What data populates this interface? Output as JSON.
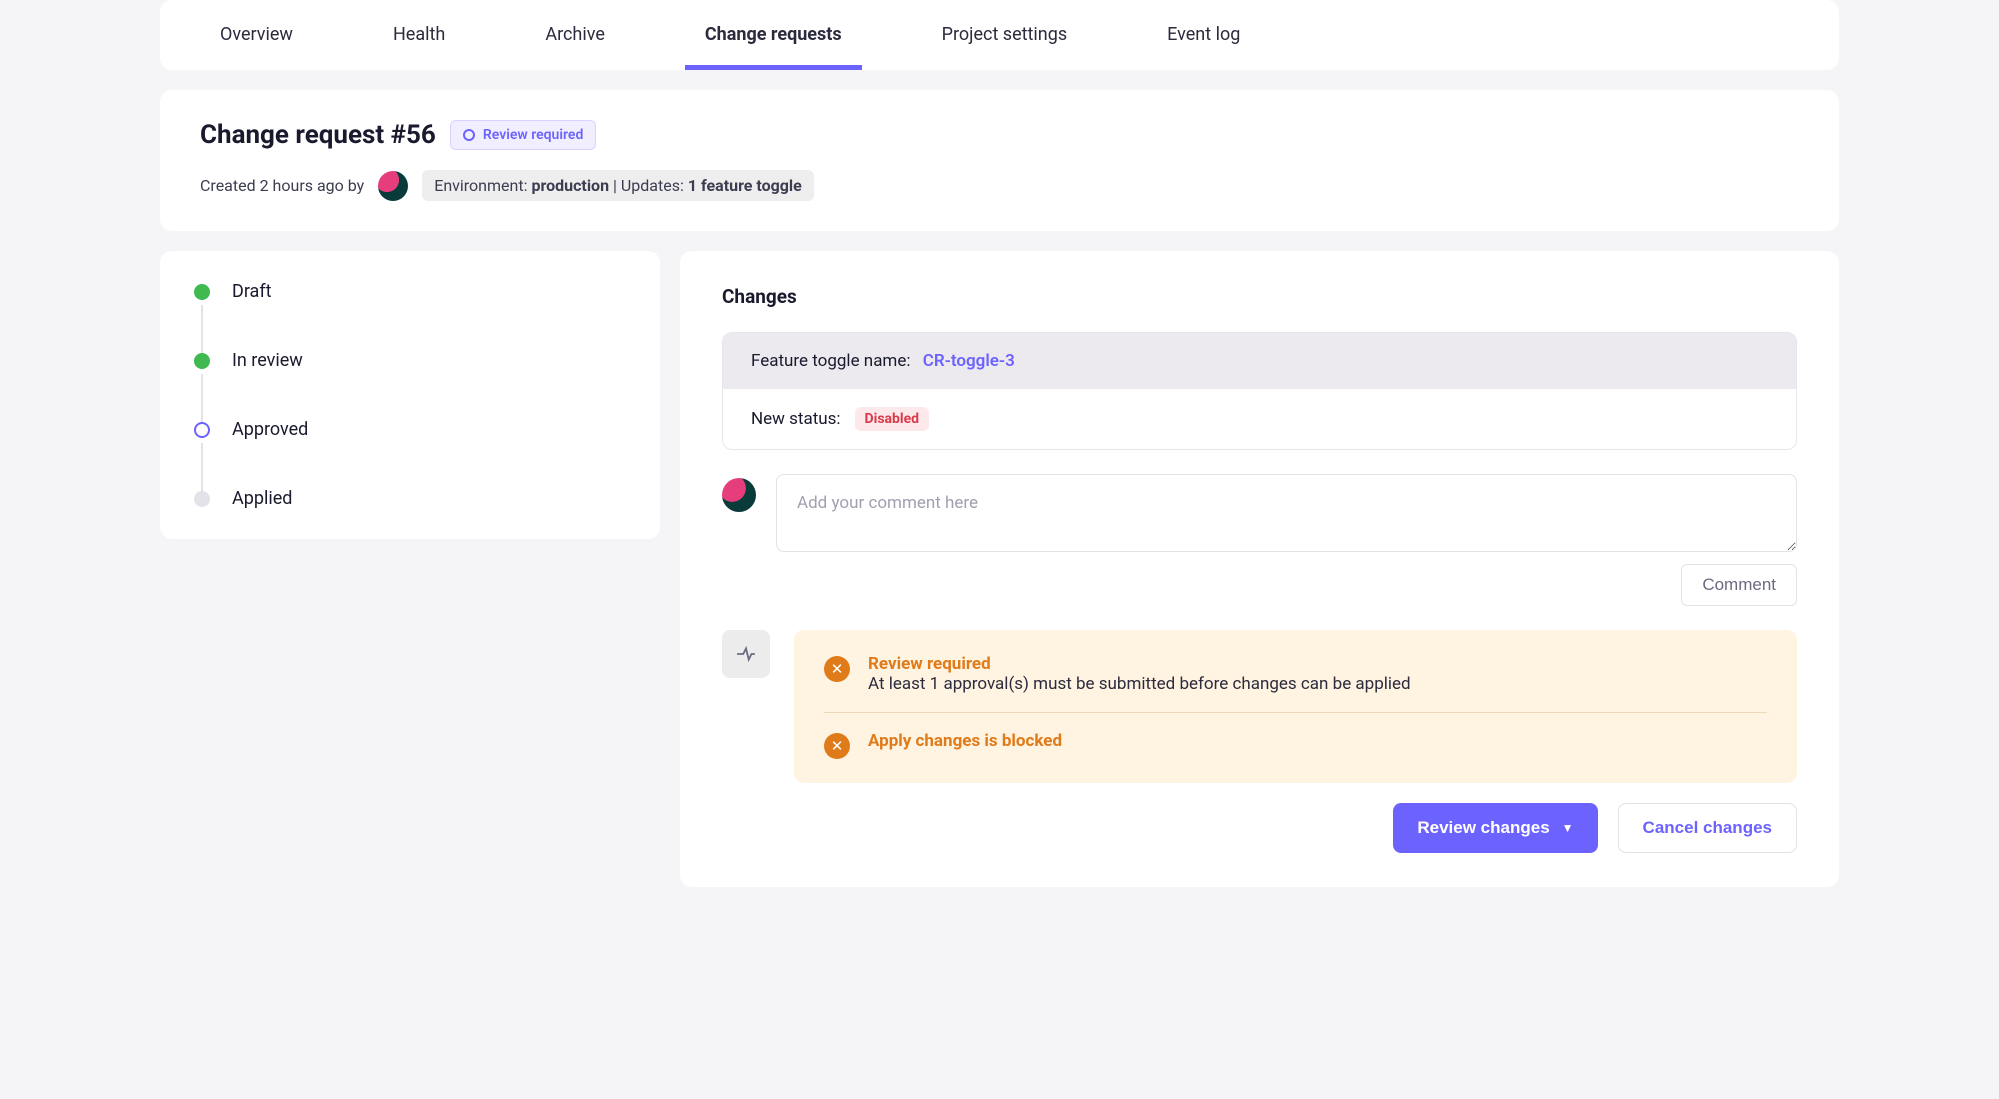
{
  "tabs": {
    "overview": "Overview",
    "health": "Health",
    "archive": "Archive",
    "change_requests": "Change requests",
    "project_settings": "Project settings",
    "event_log": "Event log",
    "active": "change_requests"
  },
  "header": {
    "title": "Change request #56",
    "badge_label": "Review required",
    "created_prefix": "Created ",
    "created_age": "2 hours ago",
    "created_by": " by",
    "env_label": "Environment: ",
    "env_value": "production",
    "updates_sep": " | Updates: ",
    "updates_value": "1 feature toggle"
  },
  "timeline": {
    "draft": "Draft",
    "in_review": "In review",
    "approved": "Approved",
    "applied": "Applied"
  },
  "changes": {
    "section_title": "Changes",
    "feature_label": "Feature toggle name:",
    "feature_name": "CR-toggle-3",
    "status_label": "New status:",
    "status_value": "Disabled"
  },
  "comment": {
    "placeholder": "Add your comment here",
    "button": "Comment"
  },
  "warnings": {
    "item1_title": "Review required",
    "item1_text": "At least 1 approval(s) must be submitted before changes can be applied",
    "item2_title": "Apply changes is blocked"
  },
  "actions": {
    "review": "Review changes",
    "cancel": "Cancel changes"
  }
}
